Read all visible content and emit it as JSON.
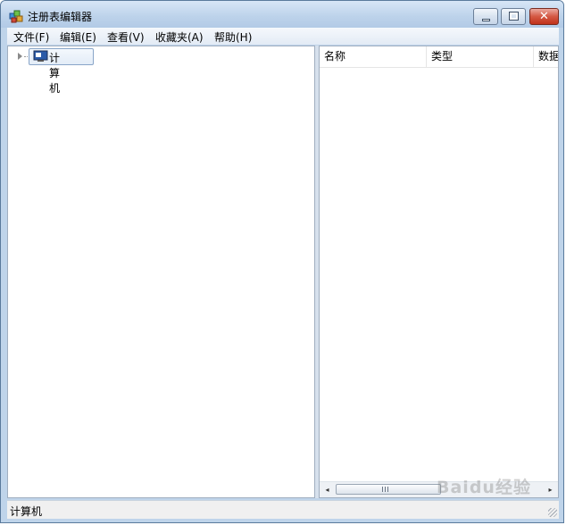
{
  "window": {
    "title": "注册表编辑器"
  },
  "title_buttons": {
    "minimize": "minimize",
    "maximize": "maximize",
    "close": "✕"
  },
  "menu": [
    "文件(F)",
    "编辑(E)",
    "查看(V)",
    "收藏夹(A)",
    "帮助(H)"
  ],
  "tree": {
    "root_label": "计算机"
  },
  "list_columns": [
    "名称",
    "类型",
    "数据"
  ],
  "scrollbar": {
    "left_arrow": "◂",
    "right_arrow": "▸"
  },
  "status": {
    "text": "计算机"
  },
  "watermark": "Baidu经验",
  "colors": {
    "close_button": "#c0321b",
    "title_gradient_top": "#d7e6f6",
    "selection_border": "#89a5c8"
  },
  "icons": {
    "app": "regedit-icon",
    "tree_root": "computer-icon"
  }
}
